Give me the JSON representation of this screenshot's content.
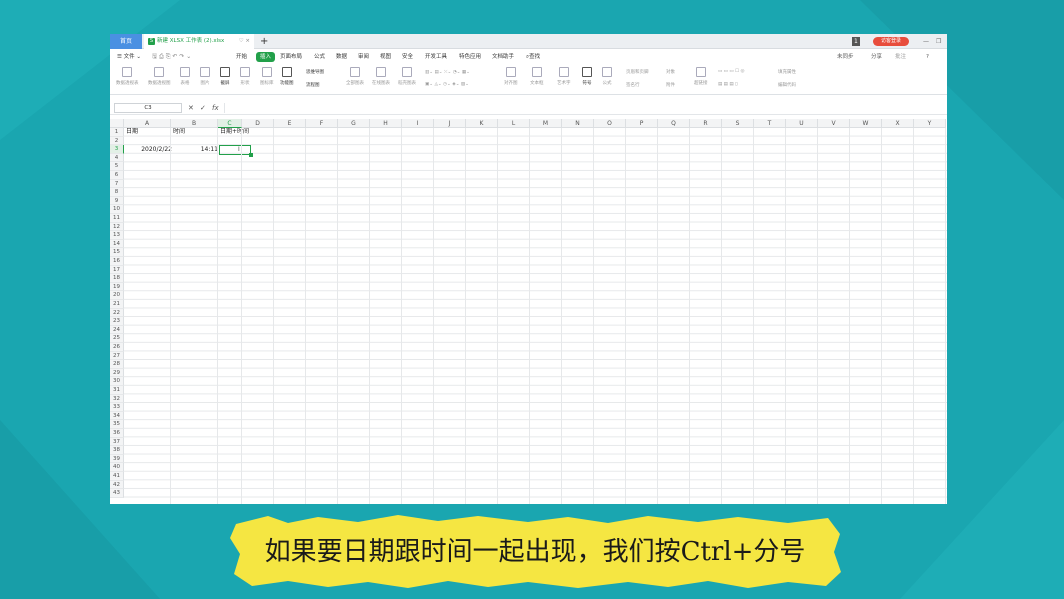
{
  "window": {
    "home_tab": "首页",
    "doc_tab": "新建 XLSX 工作表 (2).xlsx",
    "doc_badge": "S",
    "doc_tab_controls": "♡ ×",
    "new_tab": "+",
    "top_right": {
      "num_badge": "1",
      "login": "访客登录",
      "min": "—",
      "restore": "❐"
    }
  },
  "menu": {
    "file": "☰ 文件 ⌄",
    "quick_icons": "🖫 ⎙ ⎘ ↶ ↷ ⌄",
    "items": [
      "开始",
      "插入",
      "页面布局",
      "公式",
      "数据",
      "审阅",
      "视图",
      "安全",
      "开发工具",
      "特色应用",
      "文档助手"
    ],
    "active_index": 1,
    "search": "查找",
    "right": {
      "sync": "未同步",
      "share": "分享",
      "comment": "批注",
      "help": "?"
    }
  },
  "ribbon": {
    "groups": [
      {
        "label": "数据透视表",
        "dark": false
      },
      {
        "label": "数据透视图",
        "dark": false
      },
      {
        "label": "表格",
        "dark": false
      },
      {
        "label": "图片",
        "dark": false
      },
      {
        "label": "截屏",
        "dark": true
      },
      {
        "label": "形状",
        "dark": false
      },
      {
        "label": "图标库",
        "dark": false
      },
      {
        "label": "功能图",
        "dark": true
      },
      {
        "label": "全部图表",
        "dark": false
      },
      {
        "label": "在线图表",
        "dark": false
      },
      {
        "label": "稻壳图表",
        "dark": false
      },
      {
        "label": "对齐图",
        "dark": false
      },
      {
        "label": "文本框",
        "dark": false
      },
      {
        "label": "艺术字",
        "dark": false
      },
      {
        "label": "符号",
        "dark": true
      },
      {
        "label": "公式",
        "dark": false
      }
    ],
    "small": {
      "mind_map": "思维导图",
      "flow_chart": "流程图",
      "header_footer": "页眉和页脚",
      "object": "对象",
      "attach": "附件",
      "signature": "签名行",
      "hyperlink": "超链接",
      "fill_attr": "填充属性",
      "edit_code": "编辑代码"
    }
  },
  "formula_bar": {
    "name_box": "C3",
    "cancel": "✕",
    "confirm": "✓",
    "fx": "fx",
    "value": ""
  },
  "sheet": {
    "columns": [
      "A",
      "B",
      "C",
      "D",
      "E",
      "F",
      "G",
      "H",
      "I",
      "J",
      "K",
      "L",
      "M",
      "N",
      "O",
      "P",
      "Q",
      "R",
      "S",
      "T",
      "U",
      "V",
      "W",
      "X",
      "Y"
    ],
    "selected_column": "C",
    "selected_row": 3,
    "row_count": 43,
    "cells": {
      "A1": "日期",
      "B1": "时间",
      "C1": "日期+时间",
      "A3": "2020/2/22",
      "B3": "14:11"
    },
    "text_cursor": "I"
  },
  "caption": {
    "text": "如果要日期跟时间一起出现，我们按Ctrl+分号",
    "bg_color": "#f5e642"
  },
  "colors": {
    "accent": "#22a04a",
    "background": "#1aa6b0",
    "login": "#e84d3c"
  }
}
